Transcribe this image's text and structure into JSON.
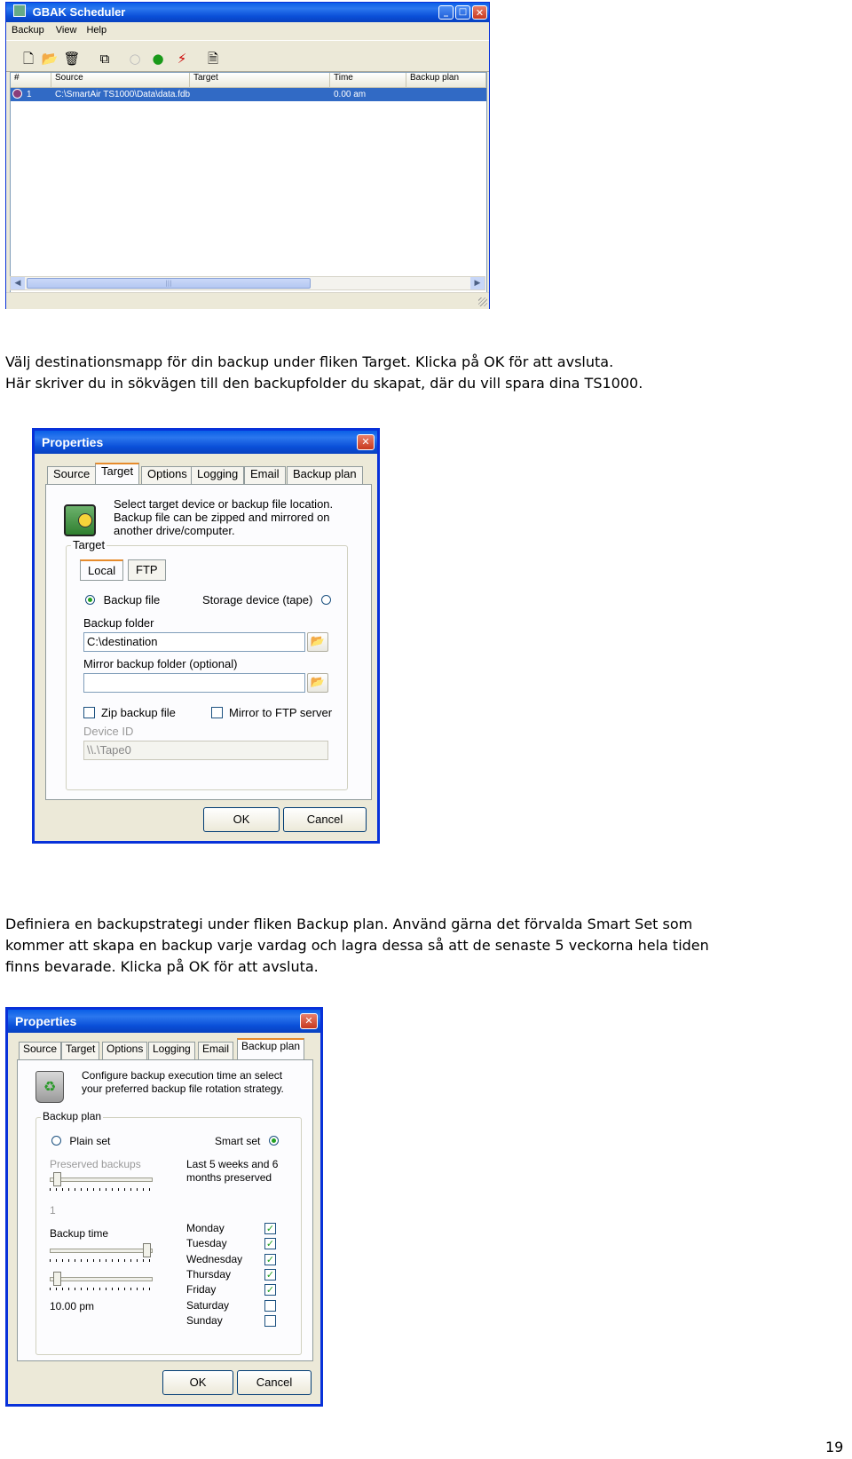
{
  "scheduler": {
    "title": "GBAK Scheduler",
    "menu": [
      "Backup",
      "View",
      "Help"
    ],
    "toolbar_icons": [
      "new-icon",
      "open-folder-icon",
      "delete-icon",
      "copy-icon",
      "stop-icon",
      "run-icon",
      "schedule-icon",
      "report-icon"
    ],
    "columns": [
      "#",
      "Source",
      "Target",
      "Time",
      "Backup plan"
    ],
    "rows": [
      {
        "num": "1",
        "source": "C:\\SmartAir TS1000\\Data\\data.fdb",
        "target": "",
        "time": "0.00 am",
        "plan": ""
      }
    ],
    "scroll_mark": "|||"
  },
  "paragraph1": {
    "line1": "Välj destinationsmapp för din backup under fliken Target. Klicka på OK för att avsluta.",
    "line2": "Här skriver du in sökvägen till den backupfolder du skapat, där du vill spara dina TS1000."
  },
  "props_target": {
    "title": "Properties",
    "tabs": [
      "Source",
      "Target",
      "Options",
      "Logging",
      "Email",
      "Backup plan"
    ],
    "description": [
      "Select target device or backup file location.",
      "Backup file can be zipped and mirrored on",
      "another drive/computer."
    ],
    "group_label": "Target",
    "subtabs": [
      "Local",
      "FTP"
    ],
    "radio_backup_file": "Backup file",
    "radio_storage": "Storage device (tape)",
    "backup_folder_label": "Backup folder",
    "backup_folder_value": "C:\\destination",
    "mirror_label": "Mirror backup folder (optional)",
    "mirror_value": "",
    "zip_label": "Zip backup file",
    "mirror_ftp_label": "Mirror to FTP server",
    "device_id_label": "Device ID",
    "device_id_value": "\\\\.\\Tape0",
    "ok": "OK",
    "cancel": "Cancel"
  },
  "paragraph2": {
    "line1": "Definiera en backupstrategi under fliken Backup plan. Använd gärna det förvalda Smart Set som",
    "line2": "kommer att skapa en backup varje vardag och lagra dessa så att de senaste 5 veckorna hela tiden",
    "line3": "finns bevarade. Klicka på OK för att avsluta."
  },
  "props_plan": {
    "title": "Properties",
    "tabs": [
      "Source",
      "Target",
      "Options",
      "Logging",
      "Email",
      "Backup plan"
    ],
    "description": [
      "Configure backup execution time an select",
      "your preferred backup file rotation strategy."
    ],
    "group_label": "Backup plan",
    "plain_set": "Plain set",
    "smart_set": "Smart set",
    "preserved_label": "Preserved backups",
    "preserved_value": "1",
    "smart_info": [
      "Last 5 weeks and 6",
      "months preserved"
    ],
    "backup_time_label": "Backup time",
    "backup_time_value": "10.00 pm",
    "days": [
      {
        "name": "Monday",
        "checked": true
      },
      {
        "name": "Tuesday",
        "checked": true
      },
      {
        "name": "Wednesday",
        "checked": true
      },
      {
        "name": "Thursday",
        "checked": true
      },
      {
        "name": "Friday",
        "checked": true
      },
      {
        "name": "Saturday",
        "checked": false
      },
      {
        "name": "Sunday",
        "checked": false
      }
    ],
    "ok": "OK",
    "cancel": "Cancel"
  },
  "page_number": "19"
}
